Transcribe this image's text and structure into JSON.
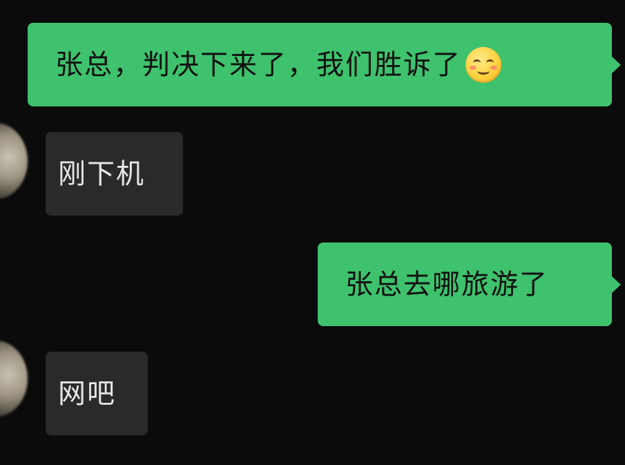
{
  "messages": [
    {
      "direction": "outgoing",
      "text": "张总，判决下来了，我们胜诉了",
      "emoji": "smiling-face-icon"
    },
    {
      "direction": "incoming",
      "text": "刚下机"
    },
    {
      "direction": "outgoing",
      "text": "张总去哪旅游了"
    },
    {
      "direction": "incoming",
      "text": "网吧"
    }
  ],
  "colors": {
    "background": "#0b0b0c",
    "outgoing_bubble": "#3ec26d",
    "incoming_bubble": "#2a2a2a",
    "incoming_text": "#e6e6e6",
    "outgoing_text": "#101010"
  }
}
